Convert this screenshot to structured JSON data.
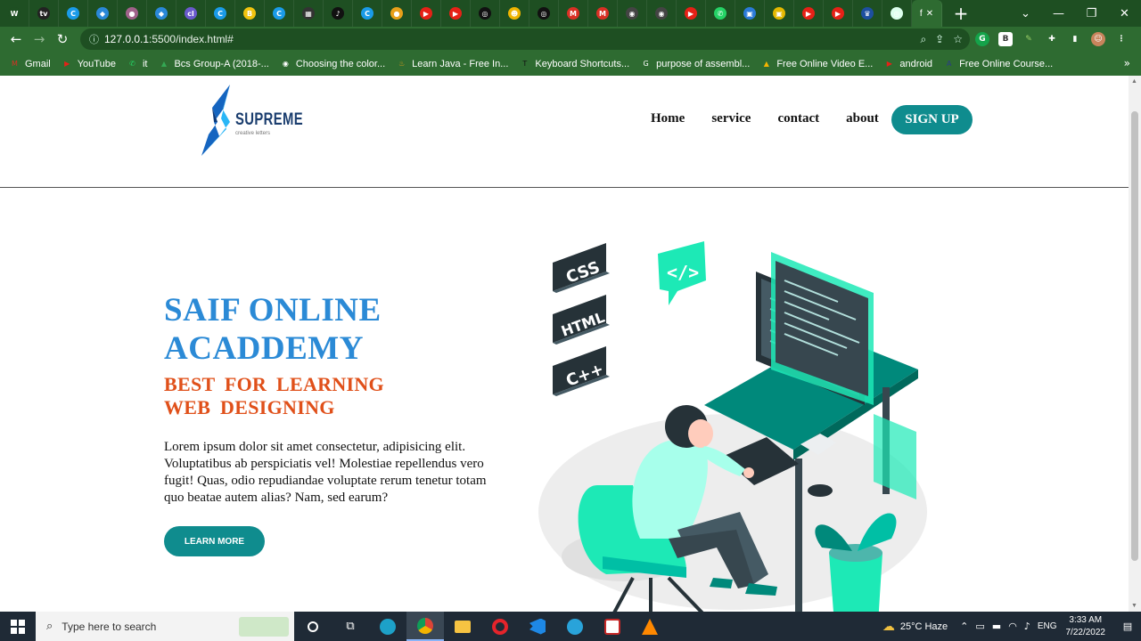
{
  "browser": {
    "tabs": [
      {
        "icon": "w-icon",
        "color": "#1e4f22",
        "glyph": "W"
      },
      {
        "icon": "tv-icon",
        "color": "#222",
        "glyph": "tv"
      },
      {
        "icon": "c-icon",
        "color": "#1a9be8",
        "glyph": "C"
      },
      {
        "icon": "drop-icon",
        "color": "#2a88d8",
        "glyph": "◆"
      },
      {
        "icon": "avatar-icon",
        "color": "#a0628a",
        "glyph": "●"
      },
      {
        "icon": "drop-icon",
        "color": "#2a88d8",
        "glyph": "◆"
      },
      {
        "icon": "cl-icon",
        "color": "#6a5acd",
        "glyph": "cl"
      },
      {
        "icon": "c-icon",
        "color": "#1a9be8",
        "glyph": "C"
      },
      {
        "icon": "b-icon",
        "color": "#f1c40f",
        "glyph": "B"
      },
      {
        "icon": "c-icon",
        "color": "#1a9be8",
        "glyph": "C"
      },
      {
        "icon": "grid-icon",
        "color": "#333",
        "glyph": "▦"
      },
      {
        "icon": "tiktok-icon",
        "color": "#111",
        "glyph": "♪"
      },
      {
        "icon": "c-icon",
        "color": "#1a9be8",
        "glyph": "C"
      },
      {
        "icon": "pin-icon",
        "color": "#e8a01a",
        "glyph": "●"
      },
      {
        "icon": "youtube-icon",
        "color": "#e62117",
        "glyph": "▶"
      },
      {
        "icon": "youtube-icon",
        "color": "#e62117",
        "glyph": "▶"
      },
      {
        "icon": "openai-icon",
        "color": "#111",
        "glyph": "◎"
      },
      {
        "icon": "emoji-icon",
        "color": "#f0b400",
        "glyph": "☻"
      },
      {
        "icon": "openai-icon",
        "color": "#111",
        "glyph": "◎"
      },
      {
        "icon": "gmail-icon",
        "color": "#d93025",
        "glyph": "M"
      },
      {
        "icon": "gmail-icon",
        "color": "#d93025",
        "glyph": "M"
      },
      {
        "icon": "globe-icon",
        "color": "#444",
        "glyph": "◉"
      },
      {
        "icon": "globe-icon",
        "color": "#444",
        "glyph": "◉"
      },
      {
        "icon": "youtube-icon",
        "color": "#e62117",
        "glyph": "▶"
      },
      {
        "icon": "whatsapp-icon",
        "color": "#25d366",
        "glyph": "✆"
      },
      {
        "icon": "image-icon",
        "color": "#2a7ad8",
        "glyph": "▣"
      },
      {
        "icon": "image-icon",
        "color": "#e4b800",
        "glyph": "▣"
      },
      {
        "icon": "youtube-icon",
        "color": "#e62117",
        "glyph": "▶"
      },
      {
        "icon": "youtube-icon",
        "color": "#e62117",
        "glyph": "▶"
      },
      {
        "icon": "shield-icon",
        "color": "#1d4fa0",
        "glyph": "♛"
      },
      {
        "icon": "chrome-icon",
        "color": "#dfe",
        "glyph": "◎"
      }
    ],
    "active_tab_glyph": "f",
    "active_tab_close": "✕",
    "new_tab": "+",
    "address_host": "127.0.0.1",
    "address_path": ":5500/index.html#",
    "bookmarks": [
      {
        "label": "Gmail",
        "color": "#d93025",
        "glyph": "M"
      },
      {
        "label": "YouTube",
        "color": "#e62117",
        "glyph": "▶"
      },
      {
        "label": "it",
        "color": "#25d366",
        "glyph": "✆"
      },
      {
        "label": "Bcs Group-A (2018-...",
        "color": "#34a853",
        "glyph": "▲"
      },
      {
        "label": "Choosing the color...",
        "color": "#fff",
        "glyph": "◉"
      },
      {
        "label": "Learn Java - Free In...",
        "color": "#e8a01a",
        "glyph": "♨"
      },
      {
        "label": "Keyboard Shortcuts...",
        "color": "#111",
        "glyph": "T"
      },
      {
        "label": "purpose of assembl...",
        "color": "#fff",
        "glyph": "G"
      },
      {
        "label": "Free Online Video E...",
        "color": "#f4b400",
        "glyph": "▲"
      },
      {
        "label": "android",
        "color": "#e62117",
        "glyph": "▶"
      },
      {
        "label": "Free Online Course...",
        "color": "#2a3a8a",
        "glyph": "A"
      }
    ],
    "bookmarks_more": "»"
  },
  "site": {
    "logo_word": "SUPREME",
    "logo_tagline": "creative letters",
    "nav": [
      "Home",
      "service",
      "contact",
      "about"
    ],
    "signup": "SIGN UP",
    "hero_title": "SAIF ONLINE ACADDEMY",
    "hero_subtitle": "BEST FOR LEARNING WEB DESIGNING",
    "hero_text": "Lorem ipsum dolor sit amet consectetur, adipisicing elit. Voluptatibus ab perspiciatis vel! Molestiae repellendus vero fugit! Quas, odio repudiandae voluptate rerum tenetur totam quo beatae autem alias? Nam, sed earum?",
    "learn_more": "LEARN MORE",
    "illustration_badges": [
      "CSS",
      "HTML",
      "C++"
    ]
  },
  "taskbar": {
    "search_placeholder": "Type here to search",
    "weather": "25°C  Haze",
    "language": "ENG",
    "time": "3:33 AM",
    "date": "7/22/2022"
  },
  "colors": {
    "chrome_dark": "#1e4f22",
    "chrome": "#2e6b31",
    "teal": "#0f8c8e",
    "hero_blue": "#2b8ad6",
    "hero_orange": "#e0501a"
  }
}
